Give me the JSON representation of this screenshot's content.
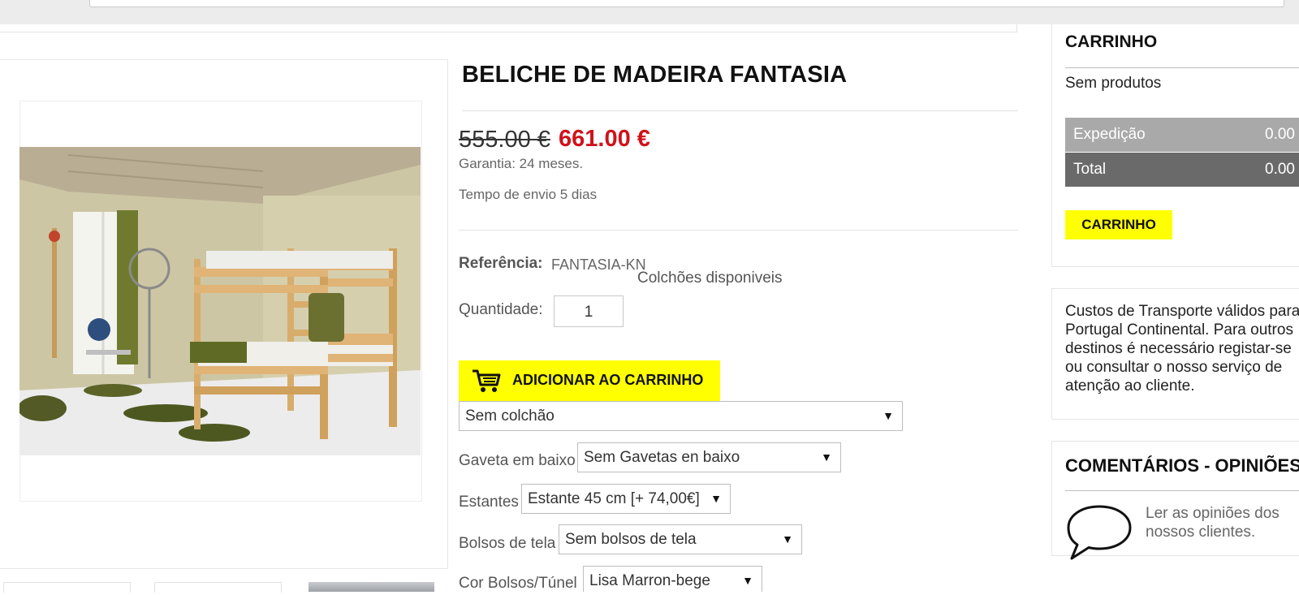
{
  "product": {
    "title": "BELICHE DE MADEIRA FANTASIA",
    "old_price": "555.00 €",
    "new_price": "661.00 €",
    "warranty": "Garantia: 24 meses.",
    "shipping_time": "Tempo de envio 5 dias",
    "reference_label": "Referência:",
    "reference_value": "FANTASIA-KN",
    "mattress_note": "Colchões disponiveis",
    "quantity_label": "Quantidade:",
    "quantity_value": "1",
    "add_to_cart_label": "ADICIONAR AO CARRINHO",
    "options": {
      "mattress": {
        "value": "Sem colchão"
      },
      "drawer": {
        "label": "Gaveta em baixo",
        "value": "Sem Gavetas en baixo"
      },
      "shelves": {
        "label": "Estantes",
        "value": "Estante 45 cm [+ 74,00€]"
      },
      "pockets": {
        "label": "Bolsos de tela",
        "value": "Sem bolsos de tela"
      },
      "pocket_color": {
        "label": "Cor Bolsos/Túnel",
        "value": "Lisa Marron-bege"
      }
    },
    "arrow": "▼"
  },
  "cart": {
    "title": "CARRINHO",
    "empty_text": "Sem produtos",
    "shipping_label": "Expedição",
    "shipping_value": "0.00",
    "total_label": "Total",
    "total_value": "0.00",
    "button_label": "CARRINHO"
  },
  "transport_note": "Custos de Transporte válidos para Portugal Continental. Para outros destinos é necessário registar-se ou consultar o nosso serviço de atenção ao cliente.",
  "reviews": {
    "title": "COMENTÁRIOS - OPINIÕES",
    "text": "Ler as opiniões dos nossos clientes."
  },
  "colors": {
    "accent_yellow": "#ffff00",
    "price_red": "#d0121b",
    "shipping_row": "#a9a9a9",
    "total_row": "#6a6a6a"
  },
  "icons": [
    "cart-icon",
    "speech-bubble-icon",
    "dropdown-arrow-icon"
  ]
}
